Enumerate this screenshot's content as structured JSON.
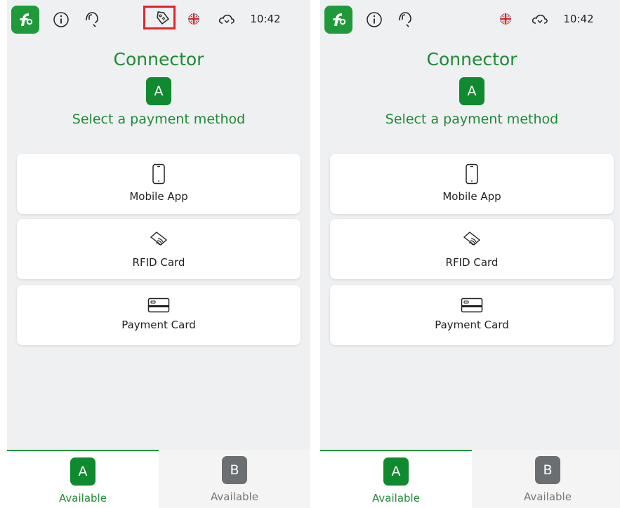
{
  "screens": [
    {
      "status": {
        "time": "10:42"
      },
      "title": "Connector",
      "connector_letter": "A",
      "subtitle": "Select a payment method",
      "payment_methods": [
        {
          "label": "Mobile App",
          "icon": "mobile-phone-icon"
        },
        {
          "label": "RFID Card",
          "icon": "rfid-card-icon"
        },
        {
          "label": "Payment Card",
          "icon": "credit-card-icon"
        }
      ],
      "tabs": [
        {
          "letter": "A",
          "status": "Available"
        },
        {
          "letter": "B",
          "status": "Available"
        }
      ]
    },
    {
      "status": {
        "time": "10:42"
      },
      "title": "Connector",
      "connector_letter": "A",
      "subtitle": "Select a payment method",
      "payment_methods": [
        {
          "label": "Mobile App",
          "icon": "mobile-phone-icon"
        },
        {
          "label": "RFID Card",
          "icon": "rfid-card-icon"
        },
        {
          "label": "Payment Card",
          "icon": "credit-card-icon"
        }
      ],
      "tabs": [
        {
          "letter": "A",
          "status": "Available"
        },
        {
          "letter": "B",
          "status": "Available"
        }
      ]
    }
  ],
  "colors": {
    "brand_green": "#1f9a3b",
    "text_green": "#1f8a36",
    "highlight_red": "#e0262b",
    "inactive_gray": "#6b6f72"
  }
}
